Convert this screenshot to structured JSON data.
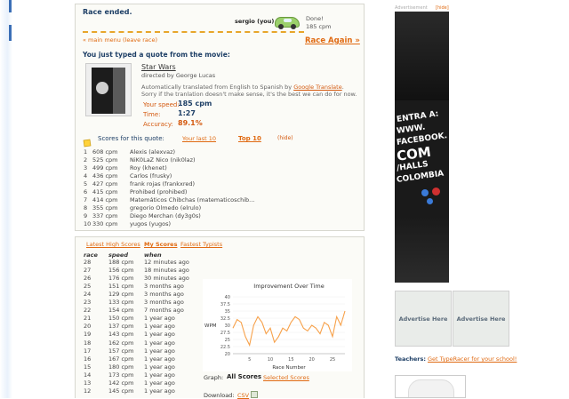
{
  "race": {
    "status": "Race ended.",
    "player": "sergio (you)",
    "done_label": "Done!",
    "done_wpm": "185 cpm",
    "main_menu_link": "« main menu (leave race)",
    "race_again": "Race Again »"
  },
  "quote": {
    "heading": "You just typed a quote from the movie:",
    "movie_title": "Star Wars",
    "director": "directed by George Lucas",
    "translation_pre": "Automatically translated from English to Spanish by",
    "translation_link": "Google Translate",
    "translation_post": ".",
    "translation_note": "Sorry if the tranlation doesn't make sense, it's the best we can do for now."
  },
  "stats": {
    "speed_label": "Your speed:",
    "speed_value": "185 cpm",
    "time_label": "Time:",
    "time_value": "1:27",
    "accuracy_label": "Accuracy:",
    "accuracy_value": "89.1%"
  },
  "scores": {
    "title": "Scores for this quote:",
    "tab_last10": "Your last 10",
    "tab_top10": "Top 10",
    "hide": "(hide)",
    "rows": [
      {
        "rank": "1",
        "cpm": "608 cpm",
        "name": "Alexis (alexvaz)"
      },
      {
        "rank": "2",
        "cpm": "525 cpm",
        "name": "NiK0LaZ Nico (nik0laz)"
      },
      {
        "rank": "3",
        "cpm": "499 cpm",
        "name": "Roy (khenet)"
      },
      {
        "rank": "4",
        "cpm": "436 cpm",
        "name": "Carlos (frusky)"
      },
      {
        "rank": "5",
        "cpm": "427 cpm",
        "name": "frank rojas (frankxred)"
      },
      {
        "rank": "6",
        "cpm": "415 cpm",
        "name": "Prohibed (prohibed)"
      },
      {
        "rank": "7",
        "cpm": "414 cpm",
        "name": "Matemáticos Chibchas (matematicoschib..."
      },
      {
        "rank": "8",
        "cpm": "355 cpm",
        "name": "gregorio Olmedo (elrulo)"
      },
      {
        "rank": "9",
        "cpm": "337 cpm",
        "name": "Diego Merchan (dy3g0s)"
      },
      {
        "rank": "10",
        "cpm": "330 cpm",
        "name": "yugos (yugos)"
      }
    ]
  },
  "history": {
    "tab_latest": "Latest High Scores",
    "tab_my": "My Scores",
    "tab_fastest": "Fastest Typists",
    "col_race": "race",
    "col_speed": "speed",
    "col_when": "when",
    "rows": [
      {
        "race": "28",
        "speed": "188 cpm",
        "when": "12 minutes ago"
      },
      {
        "race": "27",
        "speed": "156 cpm",
        "when": "18 minutes ago"
      },
      {
        "race": "26",
        "speed": "176 cpm",
        "when": "30 minutes ago"
      },
      {
        "race": "25",
        "speed": "151 cpm",
        "when": "3 months ago"
      },
      {
        "race": "24",
        "speed": "129 cpm",
        "when": "3 months ago"
      },
      {
        "race": "23",
        "speed": "133 cpm",
        "when": "3 months ago"
      },
      {
        "race": "22",
        "speed": "154 cpm",
        "when": "7 months ago"
      },
      {
        "race": "21",
        "speed": "150 cpm",
        "when": "1 year ago"
      },
      {
        "race": "20",
        "speed": "137 cpm",
        "when": "1 year ago"
      },
      {
        "race": "19",
        "speed": "143 cpm",
        "when": "1 year ago"
      },
      {
        "race": "18",
        "speed": "162 cpm",
        "when": "1 year ago"
      },
      {
        "race": "17",
        "speed": "157 cpm",
        "when": "1 year ago"
      },
      {
        "race": "16",
        "speed": "167 cpm",
        "when": "1 year ago"
      },
      {
        "race": "15",
        "speed": "180 cpm",
        "when": "1 year ago"
      },
      {
        "race": "14",
        "speed": "173 cpm",
        "when": "1 year ago"
      },
      {
        "race": "13",
        "speed": "142 cpm",
        "when": "1 year ago"
      },
      {
        "race": "12",
        "speed": "145 cpm",
        "when": "1 year ago"
      }
    ],
    "graph_label": "Graph:",
    "graph_all": "All Scores",
    "graph_selected": "Selected Scores",
    "download_label": "Download:",
    "download_csv": "CSV"
  },
  "chart_data": {
    "type": "line",
    "title": "Improvement Over Time",
    "xlabel": "Race Number",
    "ylabel": "WPM",
    "xlim": [
      1,
      28
    ],
    "ylim": [
      20,
      40
    ],
    "x_ticks": [
      "5",
      "10",
      "15",
      "20",
      "25"
    ],
    "y_ticks": [
      "40",
      "37.5",
      "35",
      "32.5",
      "30",
      "27.5",
      "25",
      "22.5",
      "20"
    ],
    "color": "#f7a14a",
    "x": [
      1,
      2,
      3,
      4,
      5,
      6,
      7,
      8,
      9,
      10,
      11,
      12,
      13,
      14,
      15,
      16,
      17,
      18,
      19,
      20,
      21,
      22,
      23,
      24,
      25,
      26,
      27,
      28
    ],
    "y": [
      29,
      32,
      31,
      26,
      23,
      30,
      33,
      31,
      27,
      29,
      24,
      26,
      29,
      28,
      31,
      33,
      32,
      29,
      28,
      30,
      29,
      27,
      31,
      30,
      26,
      33,
      30,
      35
    ]
  },
  "sidebar": {
    "ad_label": "Advertisement",
    "ad_hide": "[hide]",
    "ad_lines": [
      "ENTRA A:",
      "WWW.",
      "FACEBOOK.",
      "COM",
      "/HALLS",
      "COLOMBIA"
    ],
    "advertise_1": "Advertise Here",
    "advertise_2": "Advertise Here",
    "teachers_label": "Teachers:",
    "teachers_link": "Get TypeRacer for your school!"
  },
  "colors": {
    "accent": "#e06a12",
    "title_blue": "#1e3f66",
    "chart_line": "#f7a14a"
  }
}
